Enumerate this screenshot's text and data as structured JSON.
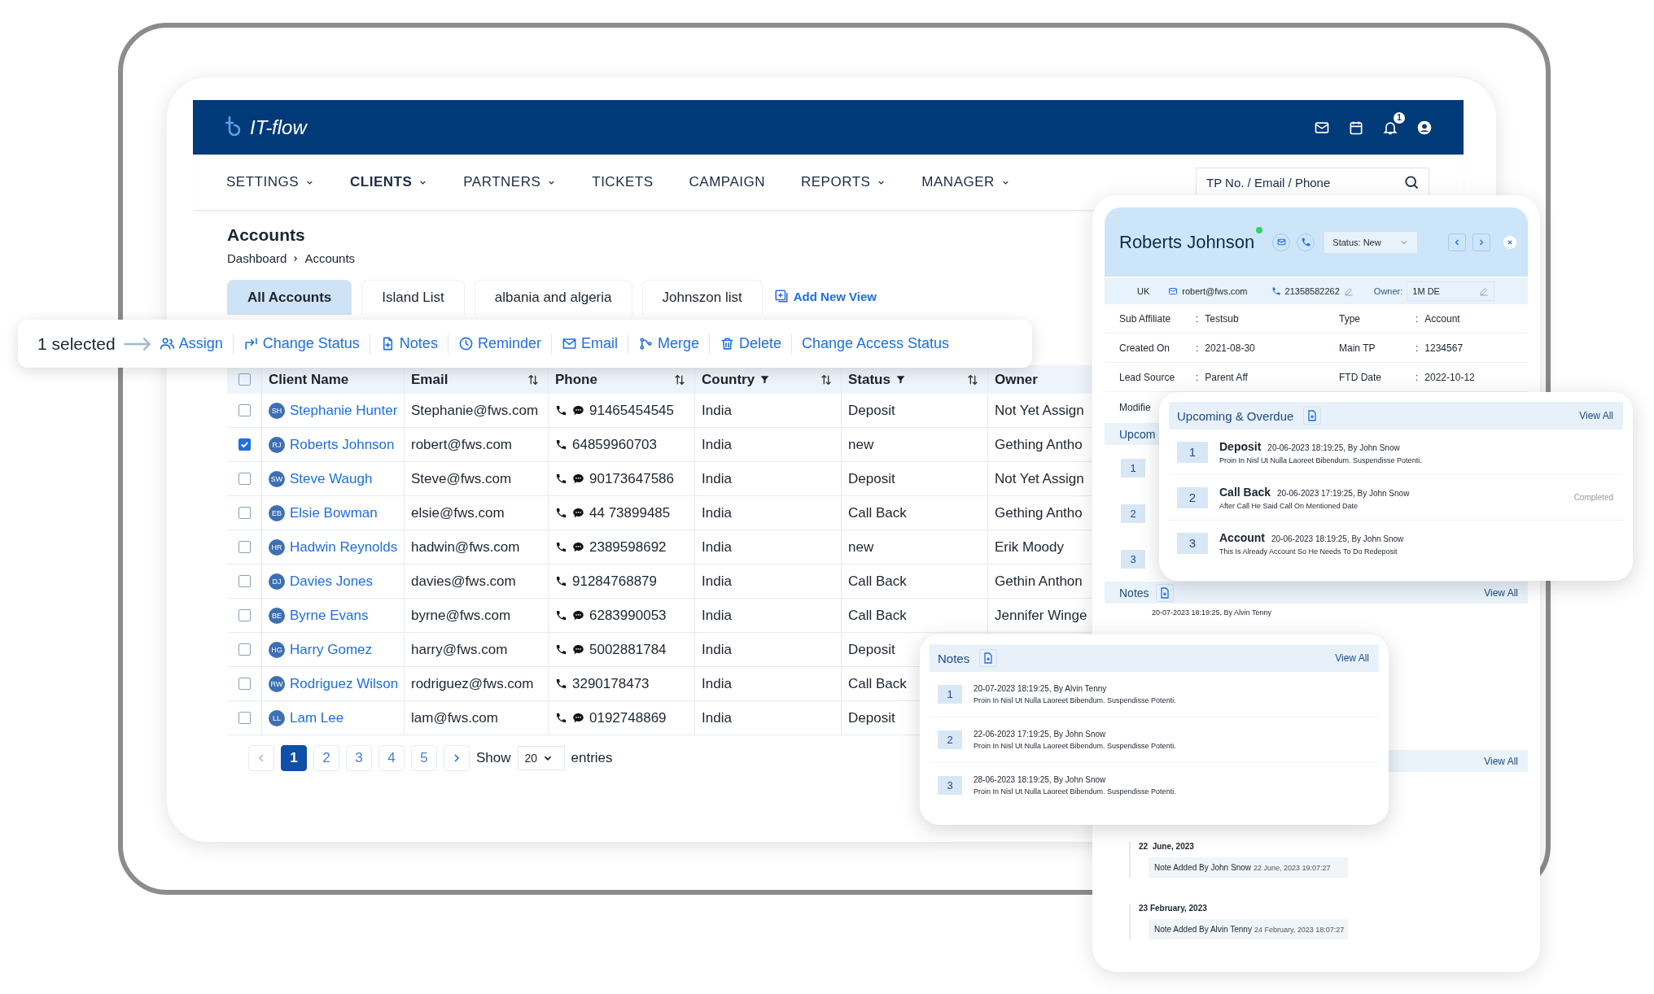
{
  "app": {
    "name": "IT-flow",
    "notification_count": "1"
  },
  "nav": {
    "items": [
      {
        "label": "SETTINGS",
        "dropdown": true,
        "selected": false
      },
      {
        "label": "CLIENTS",
        "dropdown": true,
        "selected": true
      },
      {
        "label": "PARTNERS",
        "dropdown": true,
        "selected": false
      },
      {
        "label": "TICKETS",
        "dropdown": false,
        "selected": false
      },
      {
        "label": "CAMPAIGN",
        "dropdown": false,
        "selected": false
      },
      {
        "label": "REPORTS",
        "dropdown": true,
        "selected": false
      },
      {
        "label": "MANAGER",
        "dropdown": true,
        "selected": false
      }
    ],
    "search": {
      "placeholder": "TP No. / Email / Phone"
    }
  },
  "page": {
    "title": "Accounts",
    "breadcrumb": [
      "Dashboard",
      "Accounts"
    ]
  },
  "views": {
    "tabs": [
      {
        "label": "All Accounts",
        "selected": true
      },
      {
        "label": "Island List",
        "selected": false
      },
      {
        "label": "albania and algeria",
        "selected": false
      },
      {
        "label": "Johnszon list",
        "selected": false
      }
    ],
    "add_label": "Add New View"
  },
  "selection_bar": {
    "count_label": "1 selected",
    "actions": [
      "Assign",
      "Change Status",
      "Notes",
      "Reminder",
      "Email",
      "Merge",
      "Delete",
      "Change Access Status"
    ]
  },
  "table": {
    "select_all_checked": false,
    "columns": [
      {
        "label": "Client Name",
        "sortable": false,
        "filter": false
      },
      {
        "label": "Email",
        "sortable": true,
        "filter": false
      },
      {
        "label": "Phone",
        "sortable": true,
        "filter": false
      },
      {
        "label": "Country",
        "sortable": true,
        "filter": true
      },
      {
        "label": "Status",
        "sortable": true,
        "filter": true
      },
      {
        "label": "Owner",
        "sortable": false,
        "filter": false
      }
    ],
    "rows": [
      {
        "selected": false,
        "initials": "SH",
        "name": "Stephanie Hunter",
        "email": "Stephanie@fws.com",
        "phone": "91465454545",
        "sms": true,
        "country": "India",
        "status": "Deposit",
        "owner": "Not Yet Assign"
      },
      {
        "selected": true,
        "initials": "RJ",
        "name": "Roberts Johnson",
        "email": "robert@fws.com",
        "phone": "64859960703",
        "sms": false,
        "country": "India",
        "status": "new",
        "owner": "Gething Antho"
      },
      {
        "selected": false,
        "initials": "SW",
        "name": "Steve Waugh",
        "email": "Steve@fws.com",
        "phone": "90173647586",
        "sms": true,
        "country": "India",
        "status": "Deposit",
        "owner": "Not Yet Assign"
      },
      {
        "selected": false,
        "initials": "EB",
        "name": "Elsie Bowman",
        "email": "elsie@fws.com",
        "phone": "44 73899485",
        "sms": true,
        "country": "India",
        "status": "Call Back",
        "owner": "Gething Antho"
      },
      {
        "selected": false,
        "initials": "HR",
        "name": "Hadwin Reynolds",
        "email": "hadwin@fws.com",
        "phone": "2389598692",
        "sms": true,
        "country": "India",
        "status": "new",
        "owner": "Erik Moody"
      },
      {
        "selected": false,
        "initials": "DJ",
        "name": "Davies Jones",
        "email": "davies@fws.com",
        "phone": "91284768879",
        "sms": false,
        "country": "India",
        "status": "Call Back",
        "owner": "Gethin Anthon"
      },
      {
        "selected": false,
        "initials": "BE",
        "name": "Byrne Evans",
        "email": "byrne@fws.com",
        "phone": "6283990053",
        "sms": true,
        "country": "India",
        "status": "Call Back",
        "owner": "Jennifer Winge"
      },
      {
        "selected": false,
        "initials": "HG",
        "name": "Harry Gomez",
        "email": "harry@fws.com",
        "phone": "5002881784",
        "sms": true,
        "country": "India",
        "status": "Deposit"
      },
      {
        "selected": false,
        "initials": "RW",
        "name": "Rodriguez Wilson",
        "email": "rodriguez@fws.com",
        "phone": "3290178473",
        "sms": false,
        "country": "India",
        "status": "Call Back"
      },
      {
        "selected": false,
        "initials": "LL",
        "name": "Lam Lee",
        "email": "lam@fws.com",
        "phone": "0192748869",
        "sms": true,
        "country": "India",
        "status": "Deposit"
      }
    ]
  },
  "pagination": {
    "pages": [
      {
        "label": "1",
        "selected": true
      },
      {
        "label": "2",
        "selected": false
      },
      {
        "label": "3",
        "selected": false
      },
      {
        "label": "4",
        "selected": false
      },
      {
        "label": "5",
        "selected": false
      }
    ],
    "show_label": "Show",
    "page_size": "20",
    "entries_label": "entries"
  },
  "detail": {
    "name": "Roberts Johnson",
    "online": true,
    "status_label": "Status: New",
    "country": "UK",
    "email": "robert@fws.com",
    "phone": "21358582262",
    "owner_label": "Owner:",
    "owner": "1M DE",
    "fields": [
      {
        "label": "Sub Affiliate",
        "separator": ":",
        "value": "Testsub"
      },
      {
        "label": "Type",
        "separator": ":",
        "value": "Account"
      },
      {
        "label": "Created On",
        "separator": ":",
        "value": "2021-08-30"
      },
      {
        "label": "Main TP",
        "separator": ":",
        "value": "1234567"
      },
      {
        "label": "Lead Source",
        "separator": ":",
        "value": "Parent Aff"
      },
      {
        "label": "FTD Date",
        "separator": ":",
        "value": "2022-10-12"
      }
    ],
    "cut_field_label": "Modifie",
    "upcoming_section": {
      "title": "Upcom",
      "numbers": [
        "1",
        "2",
        "3"
      ]
    },
    "notes_section": {
      "title": "Notes",
      "view_all": "View All",
      "items": [
        {
          "meta": "20-07-2023 18:19:25, By Alvin Tenny"
        }
      ]
    },
    "activity_section": {
      "view_all": "View All"
    },
    "timeline": [
      {
        "date": "22  June, 2023",
        "note": "Note Added By John Snow",
        "time": "22 June, 2023 19:07:27"
      },
      {
        "date": "23 February, 2023",
        "note": "Note Added By Alvin Tenny",
        "time": "24 February, 2023 18:07:27"
      }
    ]
  },
  "upcoming_popup": {
    "title": "Upcoming & Overdue",
    "view_all": "View All",
    "items": [
      {
        "number": "1",
        "title": "Deposit",
        "meta": "20-06-2023 18:19:25, By John Snow",
        "description": "Proin In Nisl Ut Nulla Laoreet Bibendum. Suspendisse Potenti."
      },
      {
        "number": "2",
        "title": "Call Back",
        "meta": "20-06-2023 17:19:25, By John Snow",
        "description": "After Call He Said Call On Mentioned Date",
        "status": "Completed"
      },
      {
        "number": "3",
        "title": "Account",
        "meta": "20-06-2023 18:19:25, By John Snow",
        "description": "This Is Already Account So He Needs To Do Redeposit"
      }
    ]
  },
  "notes_popup": {
    "title": "Notes",
    "view_all": "View All",
    "items": [
      {
        "number": "1",
        "meta": "20-07-2023 18:19:25, By Alvin Tenny",
        "description": "Proin In Nisl Ut Nulla Laoreet Bibendum. Suspendisse Potenti."
      },
      {
        "number": "2",
        "meta": "22-06-2023 17:19:25, By John Snow",
        "description": "Proin In Nisl Ut Nulla Laoreet Bibendum. Suspendisse Potenti."
      },
      {
        "number": "3",
        "meta": "28-06-2023 18:19:25, By John Snow",
        "description": "Proin In Nisl Ut Nulla Laoreet Bibendum. Suspendisse Potenti."
      }
    ]
  }
}
